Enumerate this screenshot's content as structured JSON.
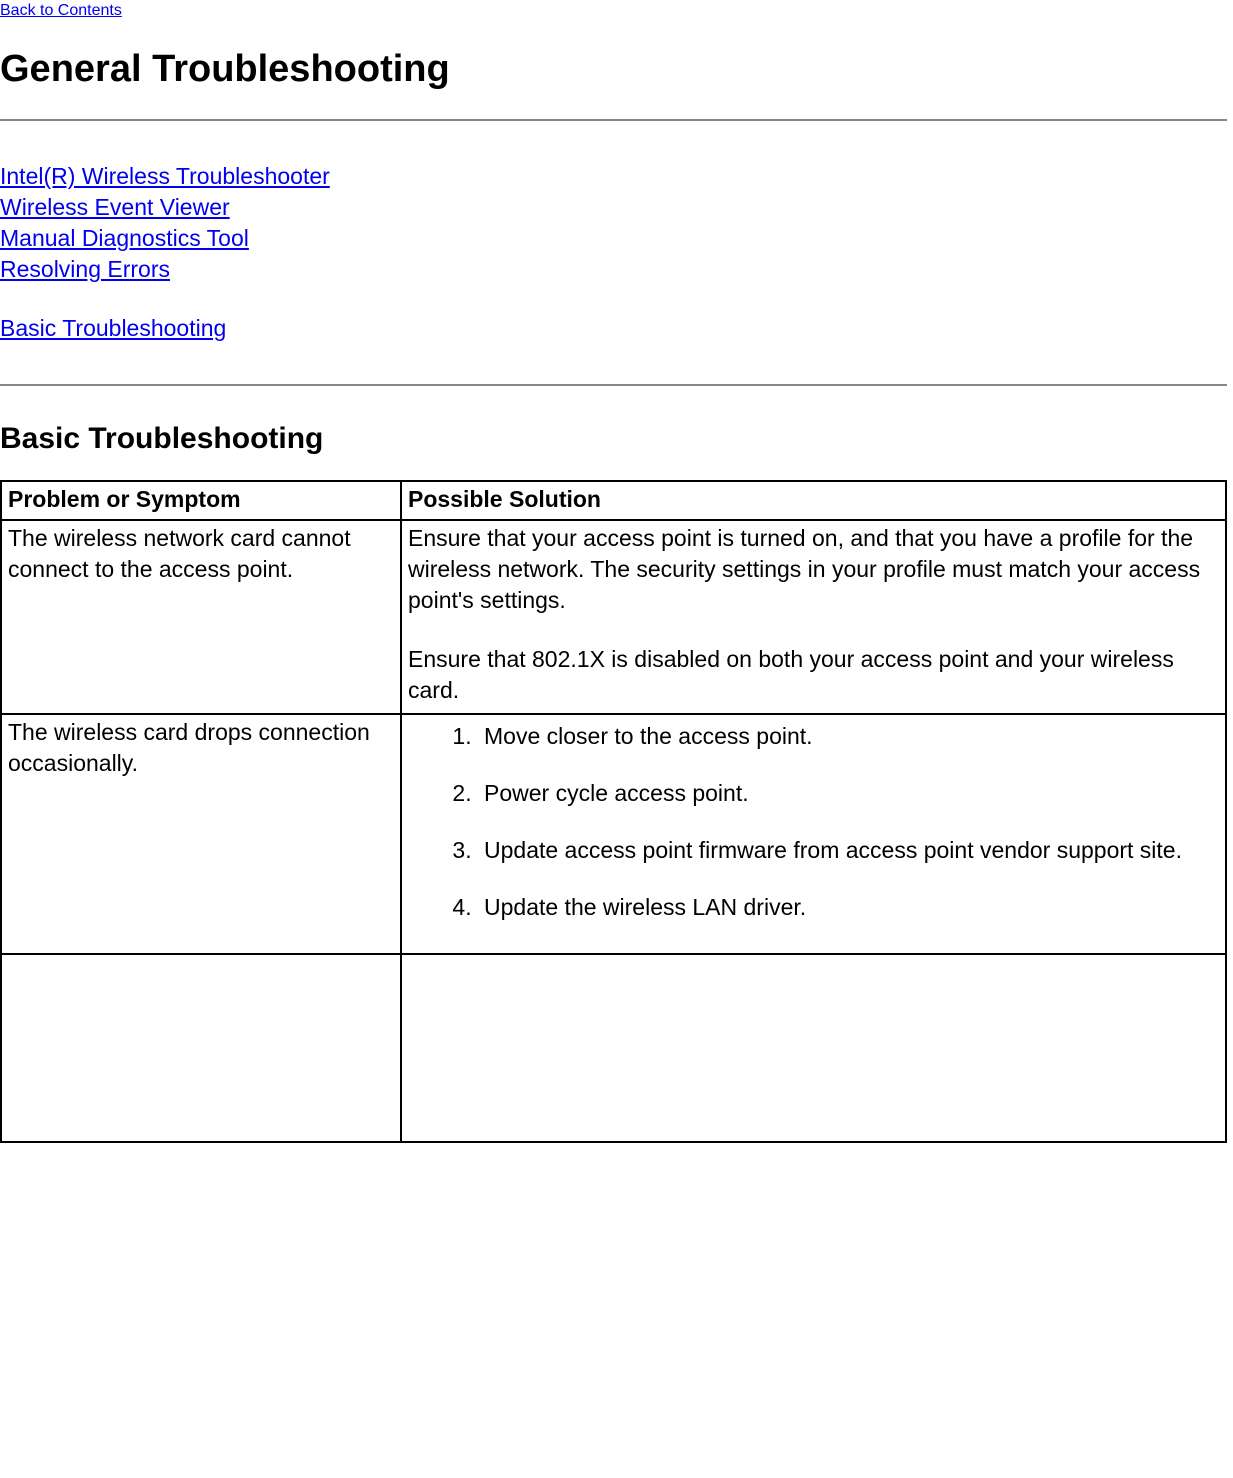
{
  "nav": {
    "back_label": "Back to Contents"
  },
  "headings": {
    "main_title": "General Troubleshooting",
    "section_title": "Basic Troubleshooting"
  },
  "toc": {
    "link1": "Intel(R) Wireless Troubleshooter",
    "link2": "Wireless Event Viewer",
    "link3": "Manual Diagnostics Tool",
    "link4": "Resolving Errors",
    "link5": "Basic Troubleshooting"
  },
  "table": {
    "header_problem": "Problem or Symptom",
    "header_solution": "Possible Solution",
    "row1": {
      "problem": "The wireless network card cannot connect to the access point.",
      "solution_p1": "Ensure that your access point is turned on, and that you have a profile for the wireless network. The security settings in your profile must match your access point's settings.",
      "solution_p2": "Ensure that 802.1X is disabled on both your access point and your wireless card."
    },
    "row2": {
      "problem": "The wireless card drops connection occasionally.",
      "steps": {
        "s1": "Move closer to the access point.",
        "s2": "Power cycle access point.",
        "s3": "Update access point firmware from access point vendor support site.",
        "s4": "Update the wireless LAN driver."
      }
    }
  }
}
